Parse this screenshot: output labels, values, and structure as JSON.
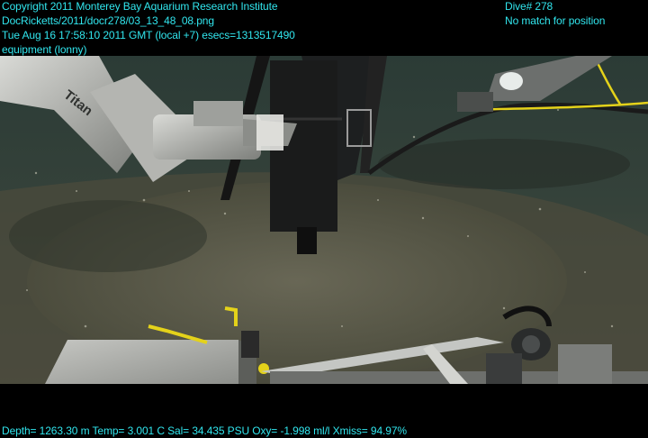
{
  "overlay": {
    "top_left": [
      "Copyright 2011 Monterey Bay Aquarium Research Institute",
      "DocRicketts/2011/docr278/03_13_48_08.png",
      "Tue Aug 16 17:58:10 2011 GMT (local +7)  esecs=1313517490",
      "equipment (lonny)"
    ],
    "top_right": [
      "Dive# 278",
      "No match for position"
    ],
    "bottom": "Depth= 1263.30 m  Temp= 3.001 C  Sal= 34.435 PSU  Oxy= -1.998 ml/l  Xmiss= 94.97%"
  },
  "scene": {
    "arm_brand_text": "Titan",
    "colors": {
      "text": "#31e6ee",
      "seafloor": "#4b4f3e",
      "water": "#2c3a34",
      "arm": "#a9aaa6",
      "cable": "#e4d21a"
    },
    "icons": [
      "manipulator-arm",
      "sampler-frame",
      "camera-light",
      "equipment-box",
      "instrument-rack"
    ]
  }
}
